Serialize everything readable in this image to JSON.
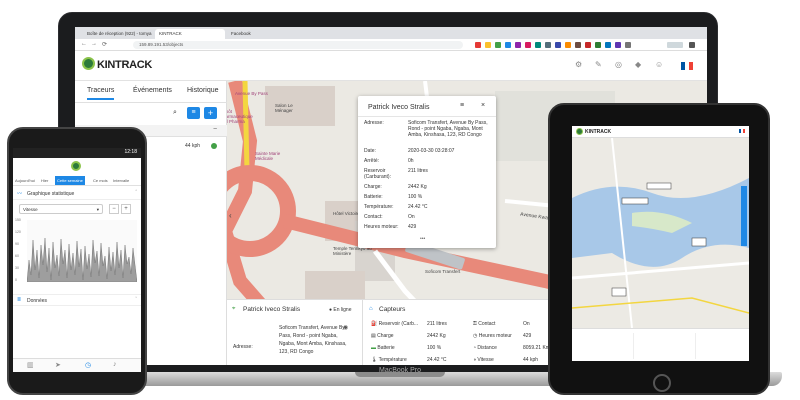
{
  "laptop": {
    "brand_label": "MacBook Pro",
    "browser": {
      "tabs": [
        "Boîte de réception (922) - tomya",
        "KINTRACK",
        "Facebook"
      ],
      "url": "159.89.191.53/objects"
    },
    "app": {
      "logo_text": "KINTRACK",
      "left_panel": {
        "tabs": [
          "Traceurs",
          "Événements",
          "Historique"
        ],
        "speed": "44 kph"
      },
      "map_labels": {
        "christine": "Christine",
        "eglise": "Eglise Armée du Salut",
        "depot": "Dépôt Pharmaceutique Cell Pharma",
        "avenue": "Avenue By Pass",
        "salon": "Salon Le Ménager",
        "sainte": "Sainte Marie Médicale",
        "hotel": "Hôtel Victoire",
        "ecole": "École Saint... (Ecole)",
        "temple": "Temple Tenrikyo au Ministère",
        "sofi": "Soficom Transfert",
        "riva": "Rivao",
        "street": "Avenue Kwango",
        "mine": "Mine"
      },
      "popup": {
        "title": "Patrick Iveco Stralis",
        "rows": [
          {
            "k": "Adresse:",
            "v": "Soficom Transfert, Avenue By Pass, Rond - point Ngaba, Ngaba, Mont Amba, Kinshasa, 123, RD Congo"
          },
          {
            "k": "Date:",
            "v": "2020-03-30 03:28:07"
          },
          {
            "k": "Arrêté:",
            "v": "0h"
          },
          {
            "k": "Reservoir (Carburant):",
            "v": "211 litres"
          },
          {
            "k": "Charge:",
            "v": "2442 Kg"
          },
          {
            "k": "Batterie:",
            "v": "100 %"
          },
          {
            "k": "Température:",
            "v": "24.42 °C"
          },
          {
            "k": "Contact:",
            "v": "On"
          },
          {
            "k": "Heures moteur:",
            "v": "429"
          }
        ],
        "more": "•••"
      },
      "bottom": {
        "title": "Patrick Iveco Stralis",
        "status": "En ligne",
        "address_label": "Adresse:",
        "address_value": "Soficom Transfert, Avenue By Pass, Rond - point Ngaba, Ngaba, Mont Amba, Kinshasa, 123, RD Congo",
        "sensors_title": "Capteurs",
        "sensors": [
          {
            "label": "Reservoir (Carb...",
            "value": "211 litres"
          },
          {
            "label": "Contact",
            "value": "On"
          },
          {
            "label": "Charge",
            "value": "2442 Kg"
          },
          {
            "label": "Heures moteur",
            "value": "429"
          },
          {
            "label": "Batterie",
            "value": "100 %"
          },
          {
            "label": "Distance",
            "value": "8059.21 Km"
          },
          {
            "label": "Température",
            "value": "24.42 °C"
          },
          {
            "label": "Vitesse",
            "value": "44 kph"
          }
        ]
      }
    }
  },
  "phone": {
    "time": "12:18",
    "tabs": [
      "Aujourd'hui",
      "Hier",
      "Cette semaine",
      "Ce mois",
      "Intervalle"
    ],
    "section1": "Graphique statistique",
    "select_value": "Vitesse",
    "y_ticks": [
      "150",
      "120",
      "90",
      "60",
      "30",
      "0"
    ],
    "section2": "Données"
  },
  "tablet": {
    "logo_text": "KINTRACK"
  },
  "colors": {
    "brand_green": "#2c7a3a",
    "accent_blue": "#1e88e5",
    "road_red": "#e8897a"
  }
}
